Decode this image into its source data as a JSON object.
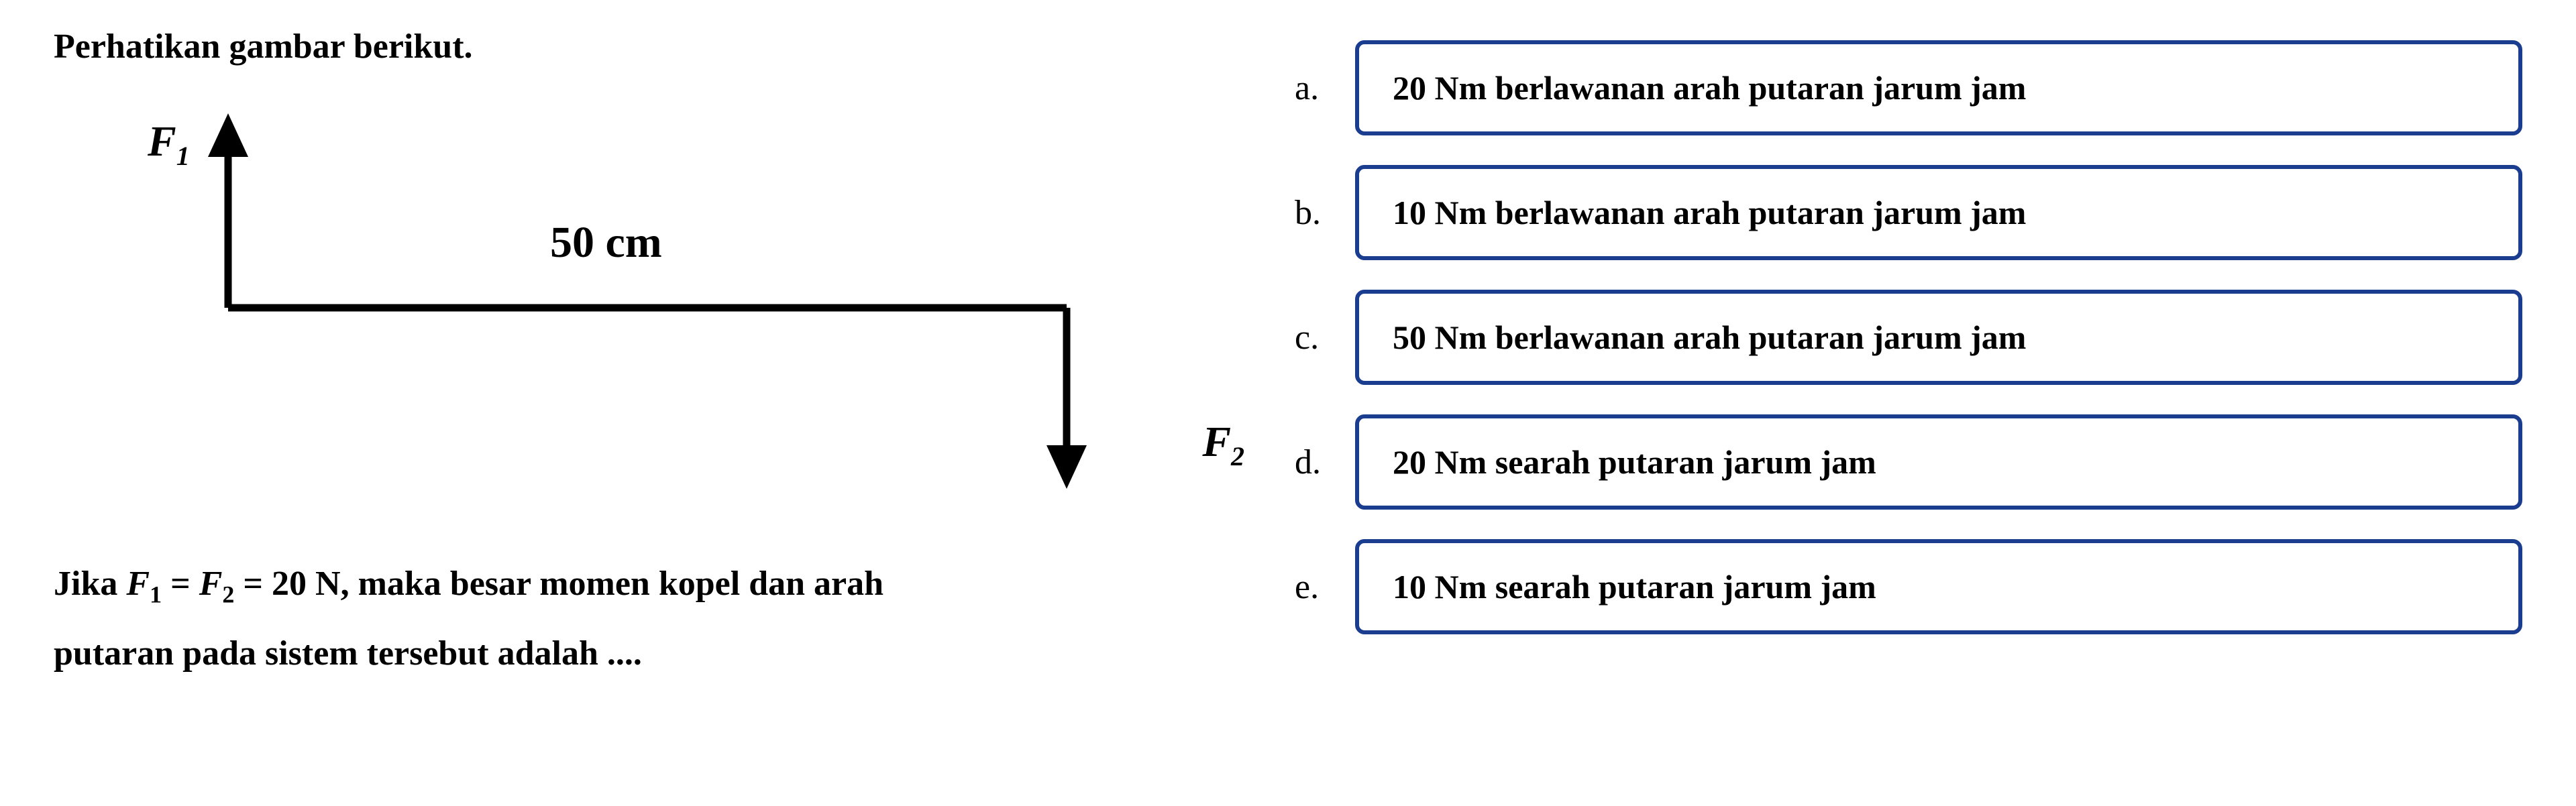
{
  "question": {
    "intro": "Perhatikan gambar berikut.",
    "diagram": {
      "f1_label": "F",
      "f1_sub": "1",
      "f2_label": "F",
      "f2_sub": "2",
      "distance": "50 cm"
    },
    "text_part1": "Jika ",
    "text_f1": "F",
    "text_f1_sub": "1",
    "text_eq": " = ",
    "text_f2": "F",
    "text_f2_sub": "2",
    "text_part2": " = 20 N, maka besar momen kopel dan arah",
    "text_part3": "putaran pada sistem tersebut adalah ...."
  },
  "options": {
    "a": {
      "letter": "a.",
      "text": "20 Nm berlawanan arah putaran jarum jam"
    },
    "b": {
      "letter": "b.",
      "text": "10 Nm berlawanan arah putaran jarum jam"
    },
    "c": {
      "letter": "c.",
      "text": "50 Nm berlawanan arah putaran jarum jam"
    },
    "d": {
      "letter": "d.",
      "text": "20 Nm searah putaran jarum jam"
    },
    "e": {
      "letter": "e.",
      "text": "10 Nm searah putaran jarum jam"
    }
  }
}
